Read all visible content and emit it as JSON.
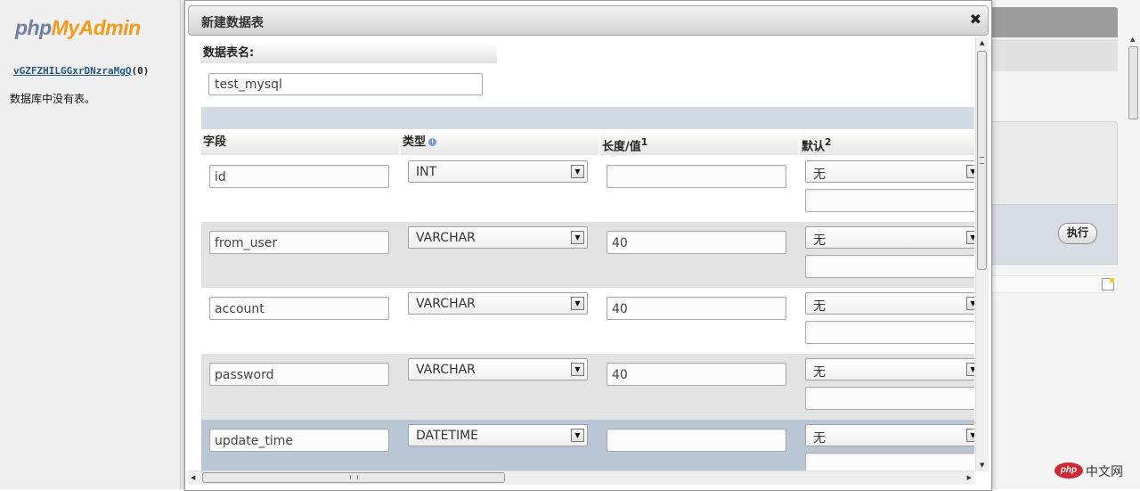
{
  "sidebar": {
    "logo_part1": "php",
    "logo_part2": "MyAdmin",
    "db_link": "vGZFZHILGGxrDNzraMgQ",
    "db_count": "(0)",
    "no_tables_text": "数据库中没有表。"
  },
  "background": {
    "execute_label": "执行"
  },
  "dialog": {
    "title": "新建数据表",
    "close_glyph": "✖",
    "table_name_label": "数据表名:",
    "table_name_value": "test_mysql",
    "columns": {
      "field": "字段",
      "type": "类型",
      "length": "长度/值",
      "length_sup": "1",
      "default": "默认",
      "default_sup": "2"
    },
    "rows": [
      {
        "name": "id",
        "type": "INT",
        "length": "",
        "default": "无"
      },
      {
        "name": "from_user",
        "type": "VARCHAR",
        "length": "40",
        "default": "无"
      },
      {
        "name": "account",
        "type": "VARCHAR",
        "length": "40",
        "default": "无"
      },
      {
        "name": "password",
        "type": "VARCHAR",
        "length": "40",
        "default": "无"
      },
      {
        "name": "update_time",
        "type": "DATETIME",
        "length": "",
        "default": "无"
      }
    ]
  },
  "watermark": {
    "pill": "php",
    "text": "中文网"
  },
  "colors": {
    "row_alt": "#e3e3e3",
    "row_selected": "#b9c6d6",
    "header_bar": "#d3dbe4",
    "logo_php": "#6c7fa6",
    "logo_myadmin": "#f59a16"
  },
  "icons": {
    "close": "close-icon",
    "info": "info-icon",
    "dropdown": "chevron-down-icon",
    "note": "note-icon"
  }
}
